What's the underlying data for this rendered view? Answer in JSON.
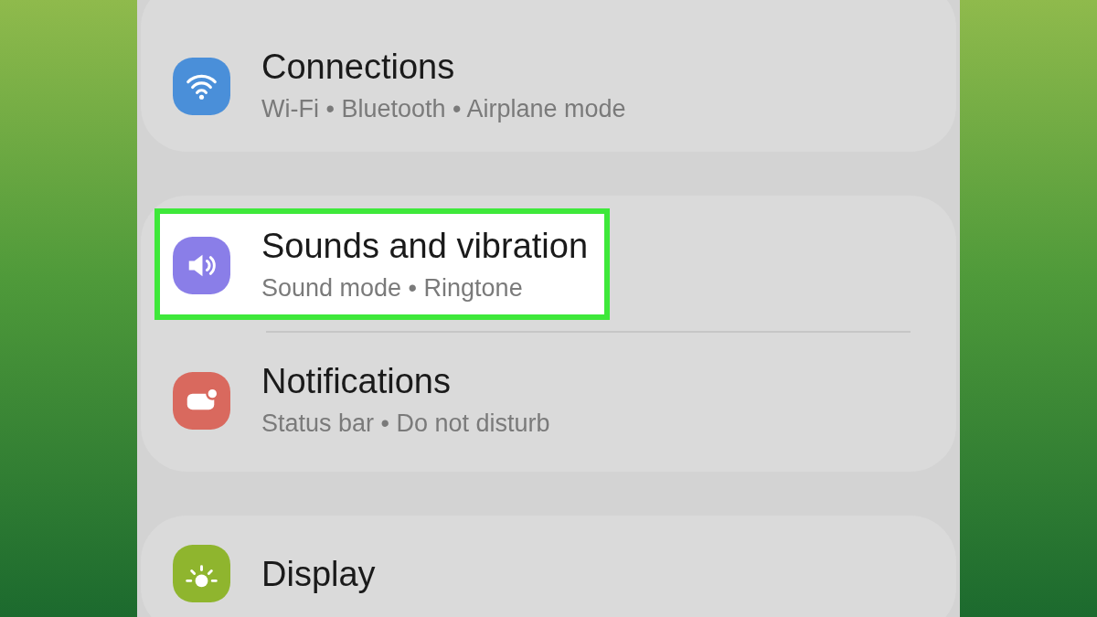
{
  "groups": [
    {
      "items": [
        {
          "kind": "wifi",
          "color": "#4a8fd9",
          "title": "Connections",
          "subtitle": "Wi-Fi • Bluetooth • Airplane mode",
          "highlighted": false
        }
      ]
    },
    {
      "items": [
        {
          "kind": "speaker",
          "color": "#8a7ee8",
          "title": "Sounds and vibration",
          "subtitle": "Sound mode • Ringtone",
          "highlighted": true
        },
        {
          "kind": "notification",
          "color": "#d9695e",
          "title": "Notifications",
          "subtitle": "Status bar • Do not disturb",
          "highlighted": false
        }
      ]
    },
    {
      "items": [
        {
          "kind": "sun",
          "color": "#8fb52e",
          "title": "Display",
          "highlighted": false
        }
      ]
    }
  ]
}
